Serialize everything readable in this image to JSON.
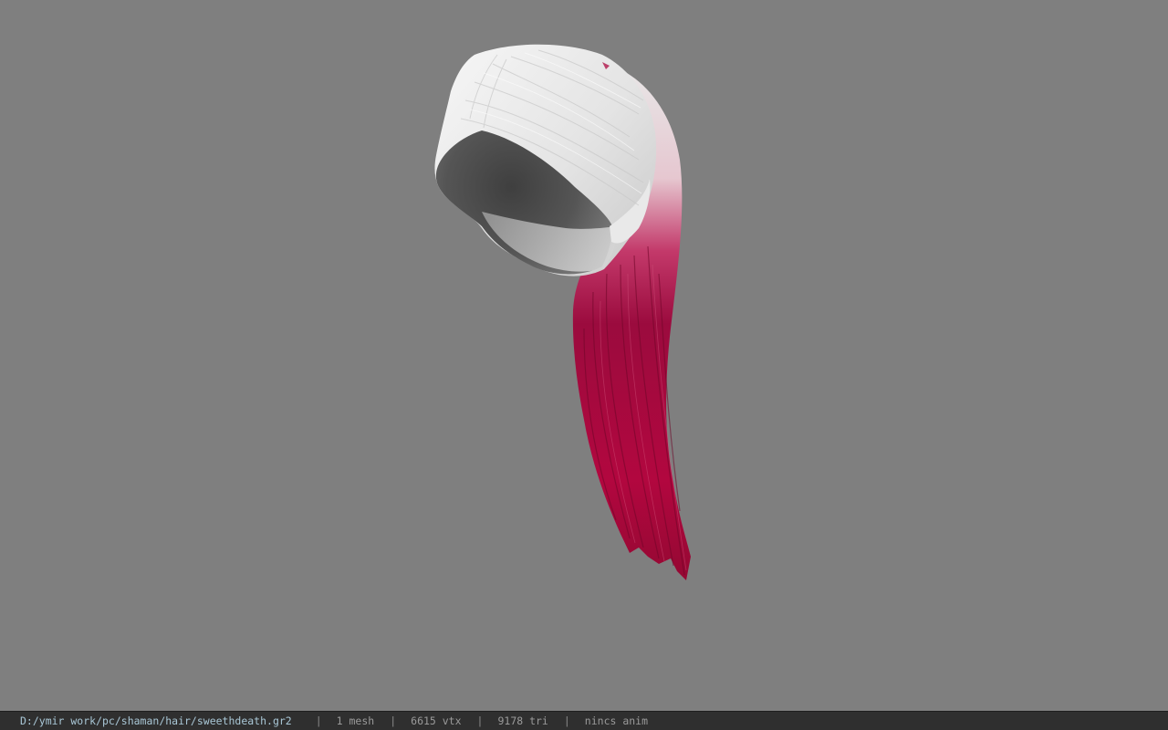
{
  "viewer": {
    "background_color": "#7f7f7f",
    "model": {
      "name": "sweethdeath",
      "colors": {
        "hair_top": "#ebebeb",
        "hair_shadow": "#5a5a5a",
        "ponytail_tip": "#a8003c"
      }
    }
  },
  "status_bar": {
    "file_path": "D:/ymir work/pc/shaman/hair/sweethdeath.gr2",
    "separator": "|",
    "mesh_count": "1 mesh",
    "vertex_count": "6615 vtx",
    "triangle_count": "9178 tri",
    "anim_status": "nincs anim"
  }
}
